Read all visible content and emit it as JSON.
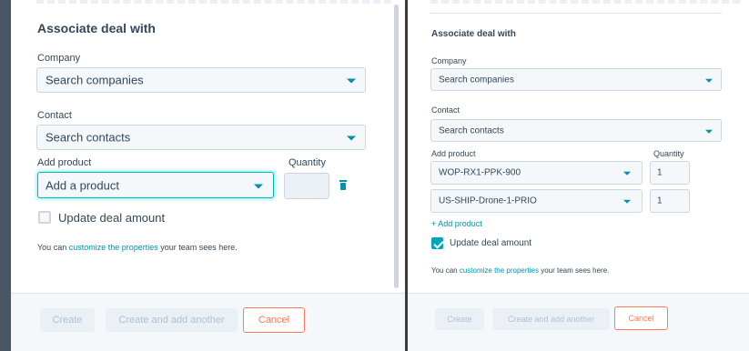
{
  "left": {
    "title": "Associate deal with",
    "company_label": "Company",
    "company_placeholder": "Search companies",
    "contact_label": "Contact",
    "contact_placeholder": "Search contacts",
    "add_product_label": "Add product",
    "quantity_label": "Quantity",
    "product_placeholder": "Add a product",
    "update_label": "Update deal amount",
    "update_checked": false,
    "note_prefix": "You can ",
    "note_link": "customize the properties",
    "note_suffix": " your team sees here.",
    "create_label": "Create",
    "create_another_label": "Create and add another",
    "cancel_label": "Cancel"
  },
  "right": {
    "title": "Associate deal with",
    "company_label": "Company",
    "company_placeholder": "Search companies",
    "contact_label": "Contact",
    "contact_placeholder": "Search contacts",
    "add_product_label": "Add product",
    "quantity_label": "Quantity",
    "products": [
      {
        "name": "WOP-RX1-PPK-900",
        "quantity": "1"
      },
      {
        "name": "US-SHIP-Drone-1-PRIO",
        "quantity": "1"
      }
    ],
    "add_product_link": "+ Add product",
    "update_label": "Update deal amount",
    "update_checked": true,
    "note_prefix": "You can ",
    "note_link": "customize the properties",
    "note_suffix": " your team sees here.",
    "create_label": "Create",
    "create_another_label": "Create and add another",
    "cancel_label": "Cancel"
  },
  "colors": {
    "accent": "#0091ae",
    "cancel": "#ff7a59",
    "text": "#33475b",
    "checkbox_on": "#00a4bd"
  }
}
